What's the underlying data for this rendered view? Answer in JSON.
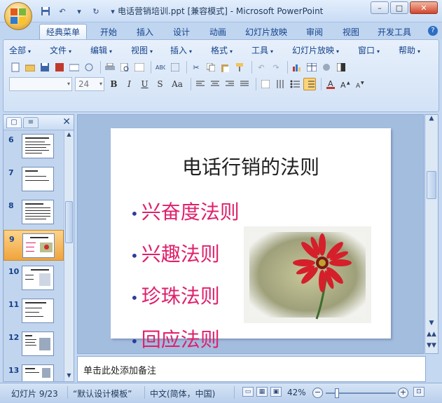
{
  "window": {
    "title": "电话营销培训.ppt [兼容模式] - Microsoft PowerPoint",
    "minimize": "–",
    "maximize": "□",
    "close": "✕"
  },
  "qat": {
    "save_icon": "save-icon",
    "undo": "↶",
    "undo_drop": "▾",
    "redo": "↻",
    "more": "▾"
  },
  "tabs": [
    {
      "label": "经典菜单",
      "active": true
    },
    {
      "label": "开始"
    },
    {
      "label": "插入"
    },
    {
      "label": "设计"
    },
    {
      "label": "动画"
    },
    {
      "label": "幻灯片放映"
    },
    {
      "label": "审阅"
    },
    {
      "label": "视图"
    },
    {
      "label": "开发工具"
    }
  ],
  "help": "?",
  "menus": [
    "全部",
    "文件",
    "编辑",
    "视图",
    "插入",
    "格式",
    "工具",
    "幻灯片放映",
    "窗口",
    "帮助"
  ],
  "format": {
    "font_name": "",
    "font_size": "24",
    "bold": "B",
    "italic": "I",
    "underline": "U",
    "strike": "S",
    "case": "Aa"
  },
  "left_pane": {
    "close": "✕",
    "slides": [
      {
        "num": "6"
      },
      {
        "num": "7"
      },
      {
        "num": "8"
      },
      {
        "num": "9",
        "selected": true
      },
      {
        "num": "10"
      },
      {
        "num": "11"
      },
      {
        "num": "12"
      },
      {
        "num": "13"
      }
    ]
  },
  "slide": {
    "title": "电话行销的法则",
    "bullets": [
      "兴奋度法则",
      "兴趣法则",
      "珍珠法则",
      "回应法则"
    ],
    "bullet_dot": "•",
    "bullet_color": "#e0206b",
    "image": "red-gerbera-flower-photo"
  },
  "notes": {
    "placeholder": "单击此处添加备注"
  },
  "status": {
    "slide_info": "幻灯片 9/23",
    "theme": "“默认设计模板”",
    "language": "中文(简体，中国)",
    "zoom": "42%",
    "zoom_out": "−",
    "zoom_in": "+"
  }
}
